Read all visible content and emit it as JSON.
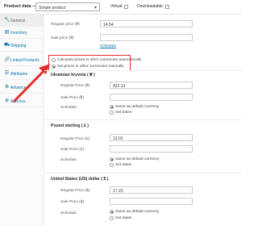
{
  "header": {
    "title": "Product data —",
    "product_type": "Simple product",
    "virtual_label": "Virtual:",
    "downloadable_label": "Downloadable:"
  },
  "sidebar": {
    "items": [
      {
        "label": "General",
        "icon": "wrench-icon",
        "active": true
      },
      {
        "label": "Inventory",
        "icon": "clipboard-icon"
      },
      {
        "label": "Shipping",
        "icon": "truck-icon"
      },
      {
        "label": "Linked Products",
        "icon": "link-icon"
      },
      {
        "label": "Attributes",
        "icon": "list-icon"
      },
      {
        "label": "Advanced",
        "icon": "gear-icon"
      },
      {
        "label": "Add-ons",
        "icon": "plus-icon"
      }
    ]
  },
  "general": {
    "regular_price_label": "Regular price (₴)",
    "regular_price_value": "14.54",
    "sale_price_label": "Sale price (₴)",
    "schedule_link": "Schedule"
  },
  "currency_mode": {
    "auto_label": "Calculate prices in other currencies automatically",
    "manual_label": "Set prices in other currencies manually",
    "selected": "manual"
  },
  "currencies": [
    {
      "title": "Ukrainian hryvnia ( ₴ )",
      "regular_label": "Regular Price (₴)",
      "regular_value": "422.13",
      "sale_label": "Sale Price (₴)",
      "schedule_label": "Schedule",
      "opt_same": "Same as default currency",
      "opt_dates": "Set dates"
    },
    {
      "title": "Pound sterling ( £ )",
      "regular_label": "Regular Price (£)",
      "regular_value": "13.01",
      "sale_label": "Sale Price (£)",
      "schedule_label": "Schedule",
      "opt_same": "Same as default currency",
      "opt_dates": "Set dates"
    },
    {
      "title": "United States (US) dollar ( $ )",
      "regular_label": "Regular Price ($)",
      "regular_value": "17.23",
      "sale_label": "Sale Price ($)",
      "schedule_label": "Schedule",
      "opt_same": "Same as default currency",
      "opt_dates": "Set dates"
    }
  ],
  "colors": {
    "accent_link": "#0073aa",
    "callout_red": "#e32d2d"
  }
}
